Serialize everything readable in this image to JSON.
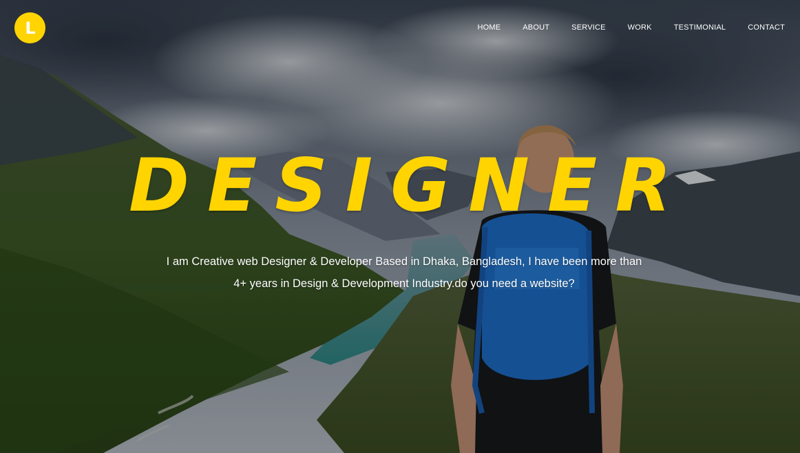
{
  "logo": {
    "letter": "L",
    "color": "#ffd400"
  },
  "nav": {
    "items": [
      {
        "label": "HOME"
      },
      {
        "label": "ABOUT"
      },
      {
        "label": "SERVICE"
      },
      {
        "label": "WORK"
      },
      {
        "label": "TESTIMONIAL"
      },
      {
        "label": "CONTACT"
      }
    ]
  },
  "hero": {
    "headline": "DESIGNER",
    "intro": "I am Creative web Designer & Developer Based in Dhaka, Bangladesh, I have been more than 4+ years in Design & Development Industry.do you need a website?",
    "accent_color": "#ffd400",
    "background": "mountain-valley-hiker-photo"
  }
}
